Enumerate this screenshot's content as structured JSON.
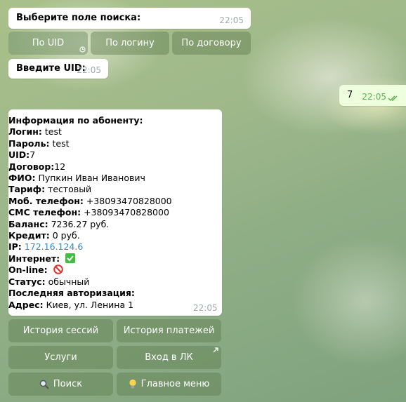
{
  "messages": {
    "search_prompt": {
      "text": "Выберите поле поиска:",
      "time": "22:05"
    },
    "enter_uid": {
      "text": "Введите UID:",
      "time": "22:05"
    },
    "user_reply": {
      "text": "7",
      "time": "22:05"
    },
    "info": {
      "header": "Информация по абоненту:",
      "fields": [
        {
          "label": "Логин:",
          "value": " test"
        },
        {
          "label": "Пароль:",
          "value": " test"
        },
        {
          "label": "UID:",
          "value": "7"
        },
        {
          "label": "Договор:",
          "value": "12"
        },
        {
          "label": "ФИО:",
          "value": " Пупкин Иван Иванович"
        },
        {
          "label": "Тариф:",
          "value": " тестовый"
        },
        {
          "label": "Моб. телефон:",
          "value": " +38093470828000"
        },
        {
          "label": "СМС телефон:",
          "value": " +38093470828000"
        },
        {
          "label": "Баланс:",
          "value": " 7236.27 руб."
        },
        {
          "label": "Кредит:",
          "value": " 0 руб."
        },
        {
          "label": "IP:",
          "value": " 172.16.124.6"
        },
        {
          "label": "Интернет:",
          "value": ""
        },
        {
          "label": "On-line:",
          "value": ""
        },
        {
          "label": "Статус:",
          "value": " обычный"
        },
        {
          "label": "Последняя авторизация:",
          "value": ""
        },
        {
          "label": "Адрес:",
          "value": " Киев, ул. Ленина 1"
        }
      ],
      "time": "22:05"
    }
  },
  "search_buttons": {
    "uid": "По UID",
    "login": "По логину",
    "contract": "По договору"
  },
  "keyboard": {
    "sessions": "История сессий",
    "payments": "История платежей",
    "services": "Услуги",
    "cabinet": "Вход в ЛК",
    "search": "Поиск",
    "main_menu": "Главное меню"
  },
  "icons": {
    "internet": "check-mark-icon",
    "online": "prohibited-icon",
    "search": "magnifier-icon",
    "main_menu": "light-bulb-icon"
  },
  "colors": {
    "link": "#2e8bc9",
    "check": "#3fbf3f",
    "prohibited": "#e0302b"
  }
}
